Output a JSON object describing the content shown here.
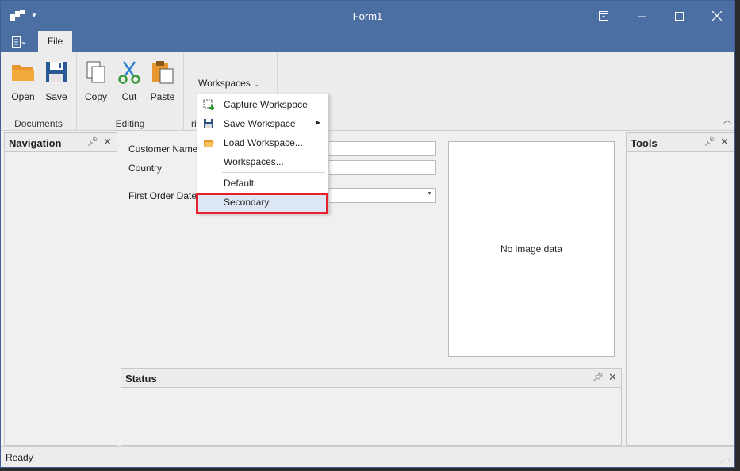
{
  "window": {
    "title": "Form1",
    "accent": "#4b6ea3"
  },
  "ribbon": {
    "tabs": [
      {
        "label": "File"
      }
    ],
    "groups": {
      "documents": {
        "label": "Documents",
        "buttons": [
          {
            "label": "Open",
            "icon": "folder-icon"
          },
          {
            "label": "Save",
            "icon": "floppy-icon"
          }
        ]
      },
      "editing": {
        "label": "Editing",
        "buttons": [
          {
            "label": "Copy",
            "icon": "copy-icon"
          },
          {
            "label": "Cut",
            "icon": "scissors-icon"
          },
          {
            "label": "Paste",
            "icon": "paste-icon"
          }
        ]
      },
      "workspaces": {
        "label_visible": "ri",
        "dropdown_label": "Workspaces"
      }
    }
  },
  "workspace_menu": {
    "items": [
      {
        "label": "Capture Workspace",
        "icon": "capture-icon"
      },
      {
        "label": "Save Workspace",
        "icon": "floppy-icon",
        "has_submenu": true
      },
      {
        "label": "Load Workspace...",
        "icon": "folder-open-icon"
      },
      {
        "label": "Workspaces..."
      },
      {
        "label": "Default"
      },
      {
        "label": "Secondary",
        "hovered": true
      }
    ],
    "highlight_color": "#e8202a"
  },
  "panels": {
    "navigation": {
      "title": "Navigation"
    },
    "tools": {
      "title": "Tools"
    },
    "status": {
      "title": "Status"
    }
  },
  "form": {
    "customer_name_label": "Customer Name",
    "country_label": "Country",
    "first_order_label": "First Order Date",
    "customer_name_value": "",
    "country_value": "",
    "first_order_value": ""
  },
  "image_box": {
    "placeholder": "No image data"
  },
  "statusbar": {
    "text": "Ready"
  }
}
